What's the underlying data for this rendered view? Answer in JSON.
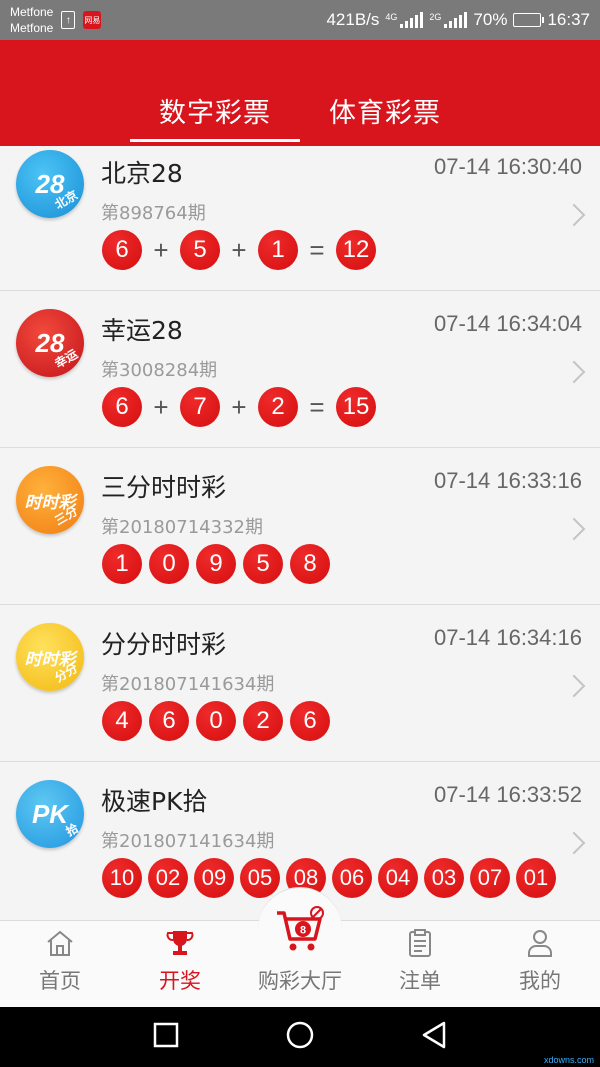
{
  "status_bar": {
    "carrier1": "Metfone",
    "carrier2": "Metfone",
    "speed": "421B/s",
    "net1": "4G",
    "net2": "2G",
    "battery": "70%",
    "battery_level": 0.7,
    "time": "16:37",
    "app_badge": "网易"
  },
  "header": {
    "tabs": [
      {
        "label": "数字彩票",
        "active": true
      },
      {
        "label": "体育彩票",
        "active": false
      }
    ]
  },
  "lotteries": [
    {
      "name": "北京28",
      "time": "07-14 16:30:40",
      "period": "第898764期",
      "logo": {
        "big": "28",
        "small": "北京",
        "color": "blue"
      },
      "numbers": [
        "6",
        "5",
        "1"
      ],
      "sum": "12"
    },
    {
      "name": "幸运28",
      "time": "07-14 16:34:04",
      "period": "第3008284期",
      "logo": {
        "big": "28",
        "small": "幸运",
        "color": "red"
      },
      "numbers": [
        "6",
        "7",
        "2"
      ],
      "sum": "15"
    },
    {
      "name": "三分时时彩",
      "time": "07-14 16:33:16",
      "period": "第20180714332期",
      "logo": {
        "big": "时时彩",
        "small": "三分",
        "color": "orange"
      },
      "numbers": [
        "1",
        "0",
        "9",
        "5",
        "8"
      ]
    },
    {
      "name": "分分时时彩",
      "time": "07-14 16:34:16",
      "period": "第201807141634期",
      "logo": {
        "big": "时时彩",
        "small": "分分",
        "color": "yellow"
      },
      "numbers": [
        "4",
        "6",
        "0",
        "2",
        "6"
      ]
    },
    {
      "name": "极速PK拾",
      "time": "07-14 16:33:52",
      "period": "第201807141634期",
      "logo": {
        "big": "PK",
        "small": "拾",
        "color": "sky"
      },
      "numbers": [
        "10",
        "02",
        "09",
        "05",
        "08",
        "06",
        "04",
        "03",
        "07",
        "01"
      ]
    }
  ],
  "operators": {
    "plus": "+",
    "equals": "="
  },
  "bottom_nav": [
    {
      "label": "首页",
      "icon": "home-icon",
      "active": false
    },
    {
      "label": "开奖",
      "icon": "trophy-icon",
      "active": true
    },
    {
      "label": "购彩大厅",
      "icon": "cart-icon",
      "active": false
    },
    {
      "label": "注单",
      "icon": "clipboard-icon",
      "active": false
    },
    {
      "label": "我的",
      "icon": "user-icon",
      "active": false
    }
  ],
  "colors": {
    "brand_red": "#d8141d",
    "ball_red": "#d50f10"
  },
  "watermark": "xdowns.com"
}
